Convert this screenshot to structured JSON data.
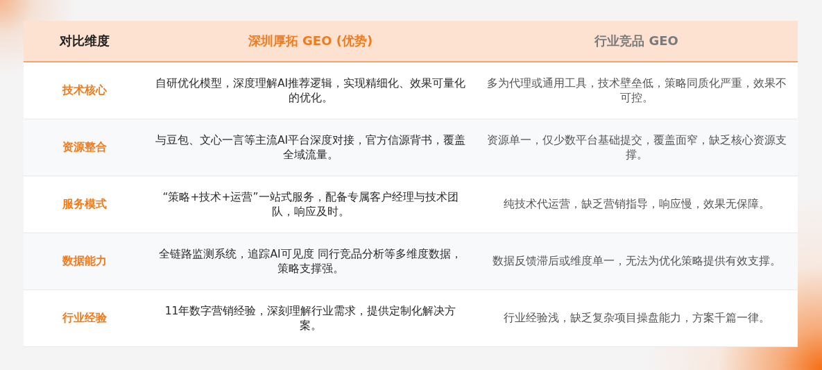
{
  "table": {
    "columns": [
      "对比维度",
      "深圳厚拓 GEO (优势)",
      "行业竞品 GEO"
    ],
    "rows": [
      {
        "dimension": "技术核心",
        "ours": "自研优化模型，深度理解AI推荐逻辑，实现精细化、效果可量化的优化。",
        "competitor": "多为代理或通用工具，技术壁垒低，策略同质化严重，效果不可控。"
      },
      {
        "dimension": "资源整合",
        "ours": "与豆包、文心一言等主流AI平台深度对接，官方信源背书，覆盖全域流量。",
        "competitor": "资源单一，仅少数平台基础提交，覆盖面窄，缺乏核心资源支撑。"
      },
      {
        "dimension": "服务模式",
        "ours": "“策略+技术+运营”一站式服务，配备专属客户经理与技术团队，响应及时。",
        "competitor": "纯技术代运营，缺乏营销指导，响应慢，效果无保障。"
      },
      {
        "dimension": "数据能力",
        "ours": "全链路监测系统，追踪AI可见度 同行竞品分析等多维度数据，策略支撑强。",
        "competitor": "数据反馈滞后或维度单一，无法为优化策略提供有效支撑。"
      },
      {
        "dimension": "行业经验",
        "ours": "11年数字营销经验，深刻理解行业需求，提供定制化解决方案。",
        "competitor": "行业经验浅，缺乏复杂项目操盘能力，方案千篇一律。"
      }
    ]
  }
}
